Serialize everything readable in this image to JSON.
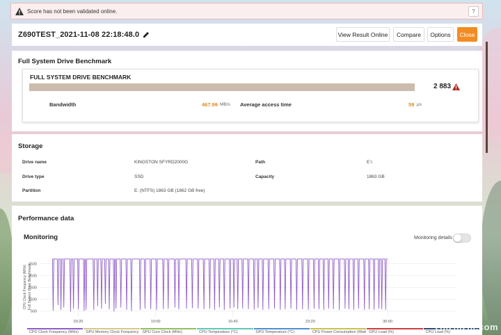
{
  "warning": {
    "message": "Score has not been validated online.",
    "help_label": "?"
  },
  "header": {
    "title": "Z690TEST_2021-11-08 22:18:48.0",
    "buttons": {
      "view_online": "View Result Online",
      "compare": "Compare",
      "options": "Options",
      "close": "Close"
    }
  },
  "benchmark": {
    "section_title": "Full System Drive Benchmark",
    "card_title": "FULL SYSTEM DRIVE BENCHMARK",
    "score": "2 883",
    "bandwidth_label": "Bandwidth",
    "bandwidth_value": "467.99",
    "bandwidth_unit": "MB/s",
    "access_label": "Average access time",
    "access_value": "59",
    "access_unit": "μs"
  },
  "storage": {
    "section_title": "Storage",
    "drive_name_label": "Drive name",
    "drive_name_value": "KINGSTON SFYRD2000G",
    "path_label": "Path",
    "path_value": "E:\\",
    "drive_type_label": "Drive type",
    "drive_type_value": "SSD",
    "capacity_label": "Capacity",
    "capacity_value": "1863 GB",
    "partition_label": "Partition",
    "partition_value": "E: (NTFS) 1863 GB (1862 GB free)"
  },
  "performance": {
    "section_title": "Performance data",
    "monitoring_title": "Monitoring",
    "monitoring_details_label": "Monitoring details",
    "monitoring_details_on": false
  },
  "chart_data": {
    "type": "line",
    "ylabel": "CPU Clock Frequency (MHz)",
    "ylabel2": "Full System Drive Benchmark",
    "yticks": [
      "4500",
      "3500",
      "2500",
      "1500",
      "500"
    ],
    "ylim": [
      0,
      5000
    ],
    "xticks": [
      "03:20",
      "10:00",
      "16:40",
      "23:20",
      "30:00"
    ],
    "xticks_seconds": [
      200,
      600,
      1000,
      1400,
      1800
    ],
    "xlim": [
      0,
      2160
    ],
    "grid": true,
    "series": [
      {
        "name": "CPU Clock Frequency (MHz)",
        "color": "#8e5bc8",
        "baseline": 4900,
        "dips": [
          [
            70,
            520
          ],
          [
            95,
            1000
          ],
          [
            110,
            600
          ],
          [
            125,
            800
          ],
          [
            160,
            450
          ],
          [
            175,
            700
          ],
          [
            200,
            650
          ],
          [
            230,
            500
          ],
          [
            240,
            600
          ],
          [
            280,
            600
          ],
          [
            300,
            900
          ],
          [
            320,
            700
          ],
          [
            340,
            1100
          ],
          [
            360,
            650
          ],
          [
            385,
            450
          ],
          [
            395,
            700
          ],
          [
            420,
            800
          ],
          [
            450,
            600
          ],
          [
            475,
            500
          ],
          [
            520,
            600
          ],
          [
            545,
            700
          ],
          [
            575,
            650
          ],
          [
            605,
            600
          ],
          [
            640,
            650
          ],
          [
            665,
            700
          ],
          [
            700,
            800
          ],
          [
            720,
            650
          ],
          [
            760,
            700
          ],
          [
            790,
            750
          ],
          [
            820,
            700
          ],
          [
            850,
            650
          ],
          [
            880,
            700
          ],
          [
            905,
            600
          ],
          [
            930,
            800
          ],
          [
            955,
            600
          ],
          [
            985,
            700
          ],
          [
            1005,
            800
          ],
          [
            1025,
            650
          ],
          [
            1050,
            700
          ],
          [
            1080,
            650
          ],
          [
            1110,
            600
          ],
          [
            1130,
            750
          ],
          [
            1155,
            600
          ],
          [
            1185,
            650
          ],
          [
            1215,
            700
          ],
          [
            1245,
            600
          ],
          [
            1270,
            650
          ],
          [
            1300,
            700
          ],
          [
            1330,
            600
          ],
          [
            1360,
            650
          ],
          [
            1390,
            600
          ],
          [
            1420,
            700
          ],
          [
            1445,
            650
          ],
          [
            1470,
            600
          ],
          [
            1495,
            700
          ],
          [
            1520,
            650
          ],
          [
            1550,
            600
          ],
          [
            1580,
            700
          ],
          [
            1600,
            650
          ],
          [
            1625,
            600
          ],
          [
            1650,
            700
          ],
          [
            1680,
            600
          ],
          [
            1705,
            650
          ],
          [
            1730,
            600
          ],
          [
            1755,
            700
          ],
          [
            1770,
            650
          ],
          [
            1790,
            600
          ]
        ]
      }
    ],
    "legend": [
      {
        "name": "CPU Clock Frequency (MHz)",
        "color": "#8e5bc8"
      },
      {
        "name": "GPU Memory Clock Frequency (MHz)",
        "color": "#d8c78a"
      },
      {
        "name": "GPU Core Clock (MHz)",
        "color": "#8fbf5a"
      },
      {
        "name": "CPU Temperature (°C)",
        "color": "#5ac9b8"
      },
      {
        "name": "GPU Temperature (°C)",
        "color": "#4a8fd0"
      },
      {
        "name": "CPU Power Consumption (Watts)",
        "color": "#c9c24a"
      },
      {
        "name": "GPU Load (%)",
        "color": "#d03c3c"
      },
      {
        "name": "CPU Load (%)",
        "color": "#2b4a6b"
      }
    ]
  }
}
